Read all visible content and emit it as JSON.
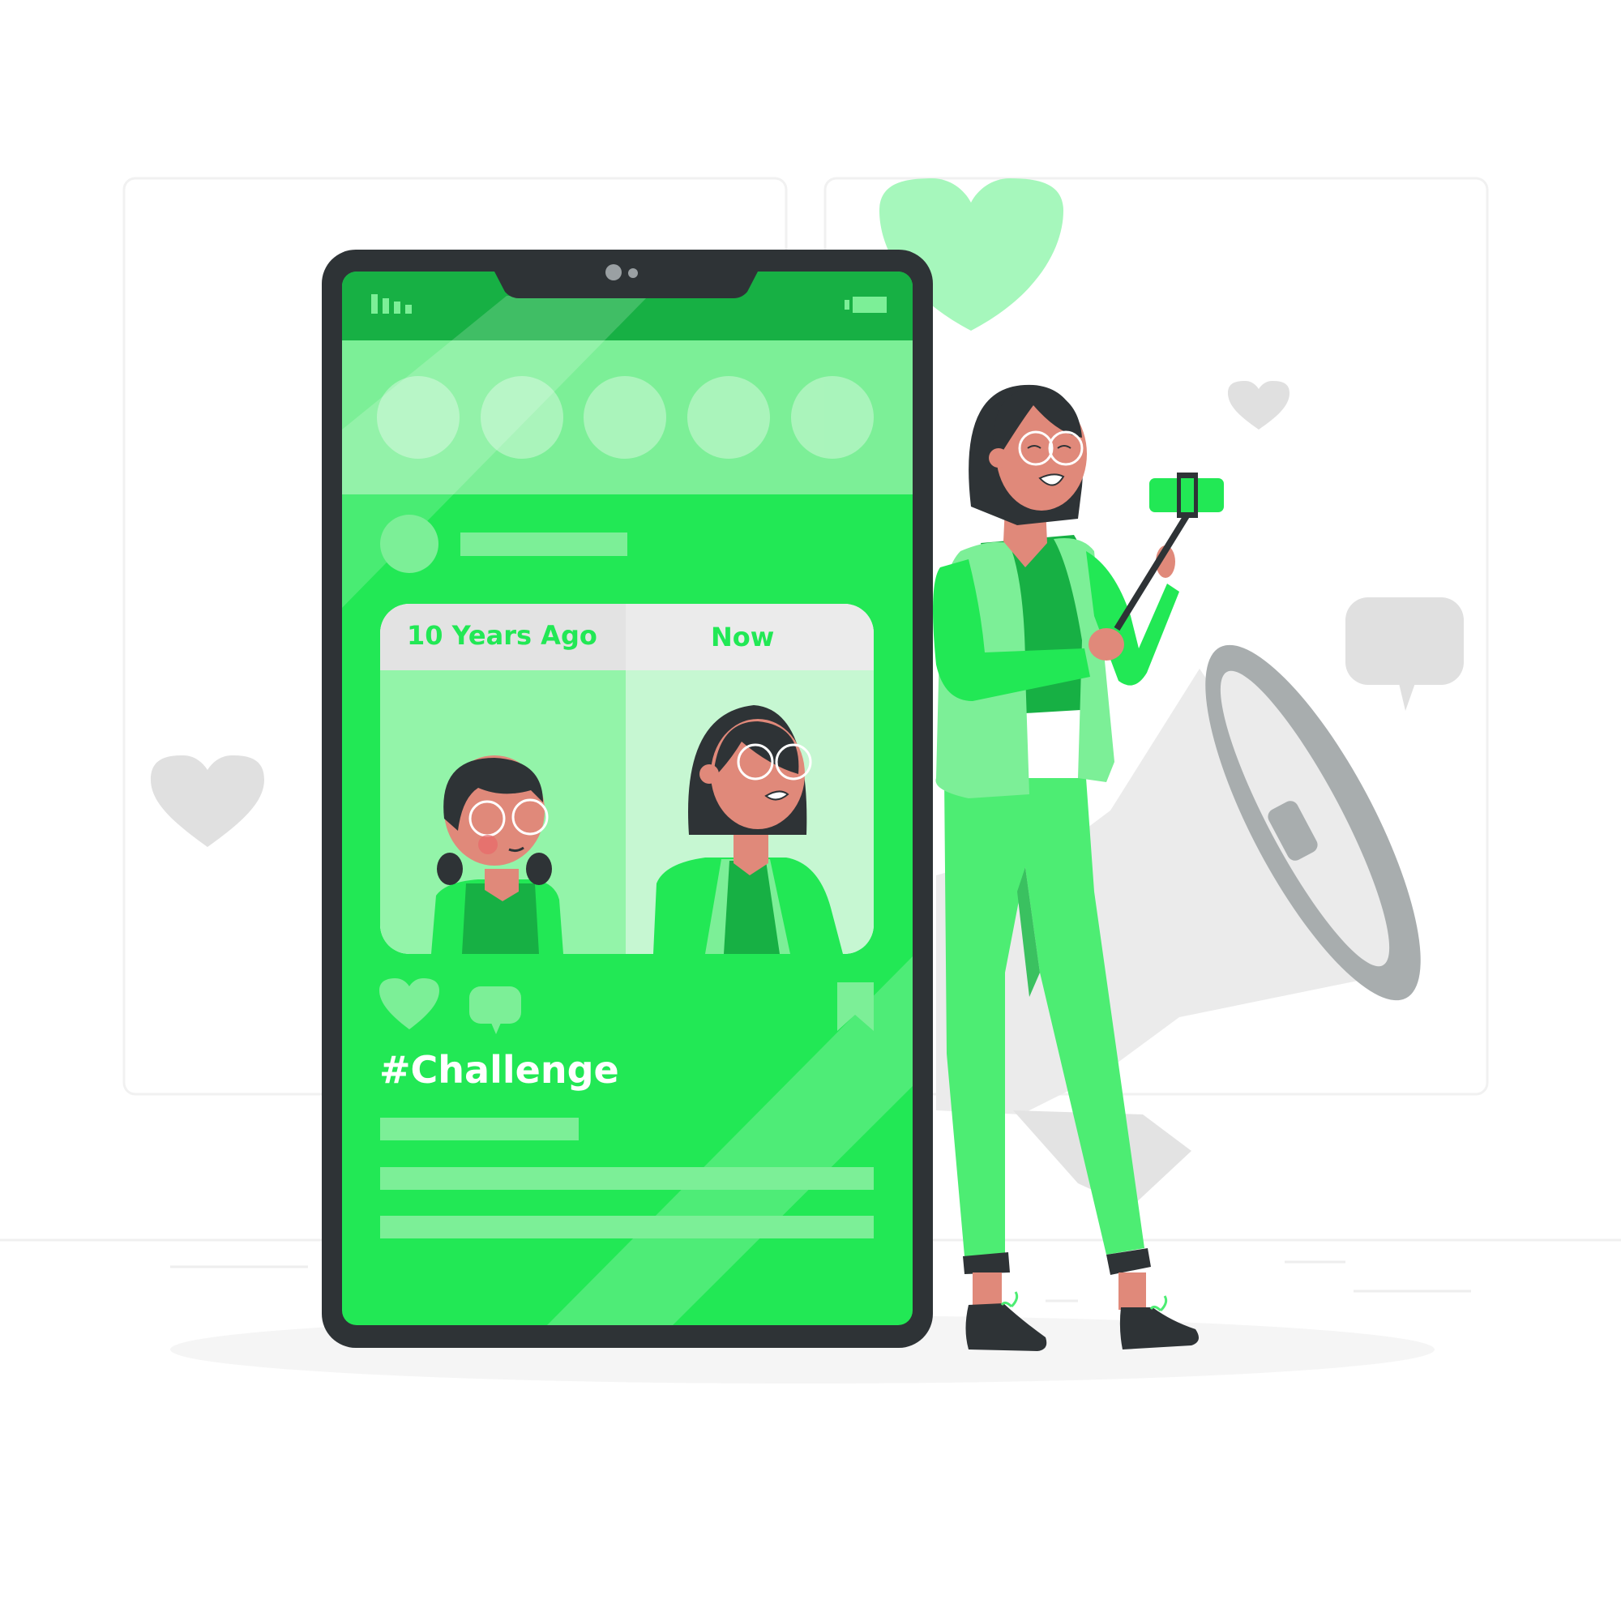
{
  "post": {
    "label_before": "10 Years Ago",
    "label_after": "Now",
    "hashtag": "#Challenge"
  },
  "icons": {
    "signal": "signal-bars-icon",
    "battery": "battery-icon",
    "camera": "front-camera-icon",
    "like": "heart-icon",
    "comment": "speech-bubble-icon",
    "bookmark": "bookmark-icon",
    "megaphone": "megaphone-icon"
  },
  "colors": {
    "brand_green": "#22E855",
    "dark_green": "#17B044",
    "light_green": "#7CEF97",
    "pale_green": "#C6F7D2",
    "phone_frame": "#2E3336",
    "gray": "#DEDEDE",
    "skin": "#E0897A"
  }
}
